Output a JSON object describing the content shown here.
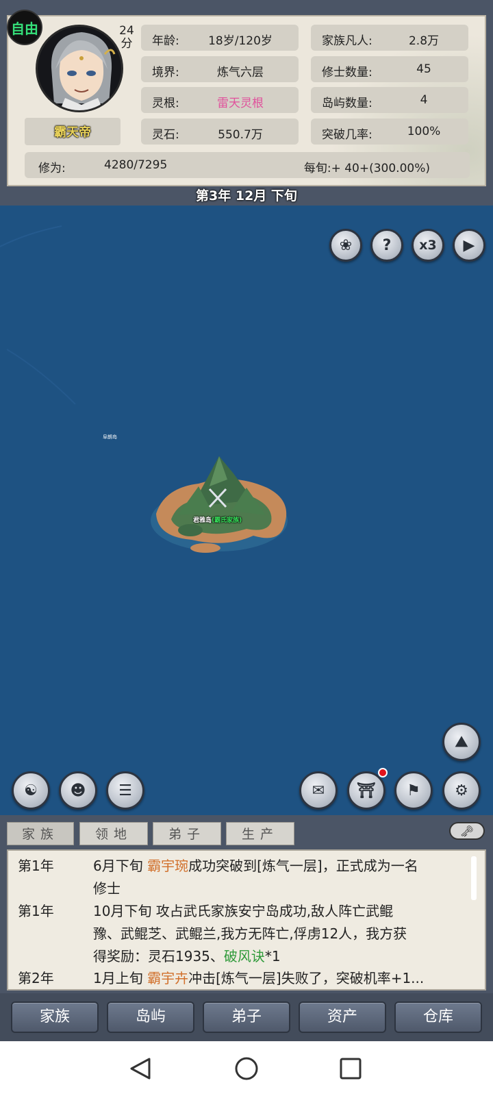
{
  "status_badge": "自由",
  "player": {
    "score_number": "24",
    "score_unit": "分",
    "name": "霸天帝"
  },
  "stats": {
    "age_label": "年龄:",
    "age_value": "18岁/120岁",
    "realm_label": "境界:",
    "realm_value": "炼气六层",
    "root_label": "灵根:",
    "root_value": "雷天灵根",
    "root_color": "#e0529c",
    "stones_label": "灵石:",
    "stones_value": "550.7万",
    "mortals_label": "家族凡人:",
    "mortals_value": "2.8万",
    "cultivators_label": "修士数量:",
    "cultivators_value": "45",
    "islands_label": "岛屿数量:",
    "islands_value": "4",
    "breakthrough_label": "突破几率:",
    "breakthrough_value": "100%"
  },
  "cultivation": {
    "label": "修为:",
    "value": "4280/7295",
    "rate": "每旬:+ 40+(300.00%)"
  },
  "date": "第3年 12月 下旬",
  "map_controls": {
    "emblem_icon": "emblem-icon",
    "help_label": "?",
    "speed_label": "x3",
    "play_icon": "play-icon"
  },
  "map": {
    "far_island_label": "阜朗岛",
    "island_name": "君雅岛",
    "island_owner": "(霸氏家族)"
  },
  "side_buttons": {
    "left": [
      "meditate-icon",
      "character-icon",
      "scroll-icon"
    ],
    "right": [
      "document-icon",
      "pavilion-icon",
      "flag-location-icon",
      "gear-icon"
    ],
    "mountain": "mountain-icon"
  },
  "log_tabs": [
    "家族",
    "领地",
    "弟子",
    "生产"
  ],
  "log": [
    {
      "year": "第1年",
      "time": "6月下旬 ",
      "name": "霸宇琬",
      "text": "成功突破到[炼气一层]，正式成为一名",
      "line2": "修士"
    },
    {
      "year": "第1年",
      "line1": "10月下旬 攻占武氏家族安宁岛成功,敌人阵亡武鲲",
      "line2": "豫、武鲲芝、武鲲兰,我方无阵亡,俘虏12人，我方获",
      "line3_pre": "得奖励：灵石1935、",
      "reward": "破风诀",
      "line3_post": "*1"
    },
    {
      "year": "第2年",
      "time": "1月上旬 ",
      "name": "霸宇卉",
      "text": "冲击[炼气一层]失败了，突破机率+1..."
    }
  ],
  "bottom_nav": [
    "家族",
    "岛屿",
    "弟子",
    "资产",
    "仓库"
  ]
}
